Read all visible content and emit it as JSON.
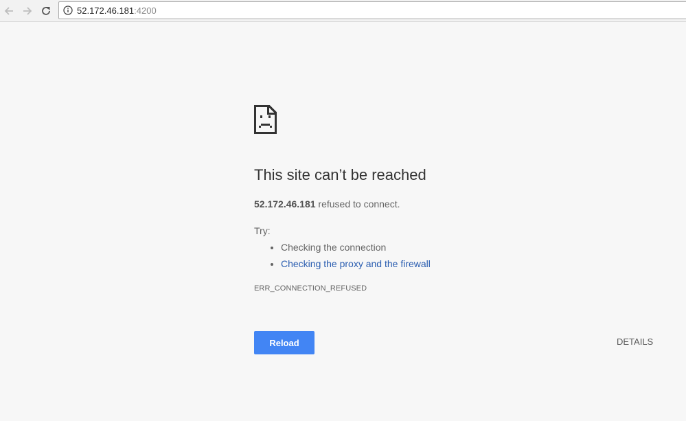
{
  "browser": {
    "url_host": "52.172.46.181",
    "url_port": ":4200",
    "icons": {
      "back": "back-arrow-icon",
      "forward": "forward-arrow-icon",
      "reload": "reload-icon",
      "info": "info-icon"
    }
  },
  "error_page": {
    "icon": "sad-document-icon",
    "title": "This site can’t be reached",
    "host": "52.172.46.181",
    "message": " refused to connect.",
    "try_label": "Try:",
    "suggestions": [
      "Checking the connection",
      "Checking the proxy and the firewall"
    ],
    "error_code": "ERR_CONNECTION_REFUSED",
    "reload_label": "Reload",
    "details_label": "DETAILS",
    "colors": {
      "reload_button": "#4285f4",
      "link": "#2a5db0"
    }
  }
}
